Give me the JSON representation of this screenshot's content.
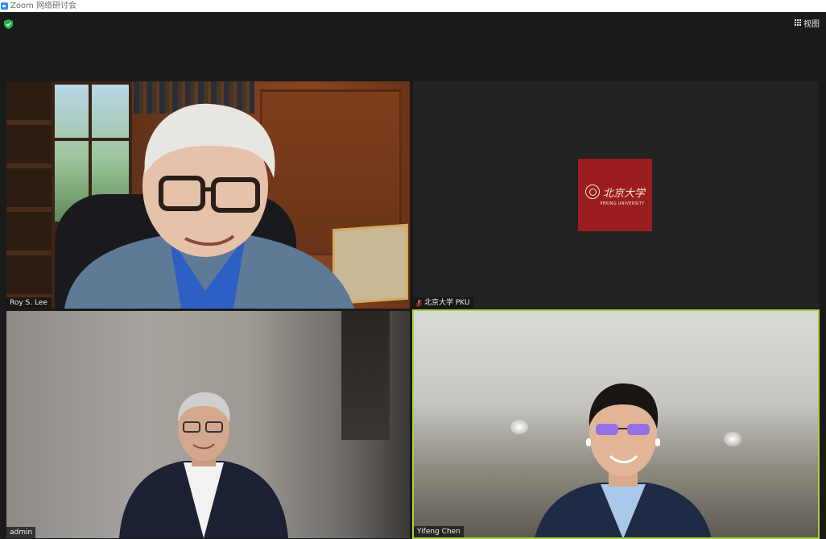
{
  "window": {
    "title": "Zoom 网络研讨会"
  },
  "toolbar": {
    "view_label": "视图"
  },
  "participants": [
    {
      "name": "Roy S. Lee",
      "muted": false
    },
    {
      "name": "北京大学 PKU",
      "muted": true
    },
    {
      "name": "admin",
      "muted": false
    },
    {
      "name": "Yifeng Chen",
      "muted": false,
      "active_speaker": true
    }
  ],
  "pku_logo": {
    "chinese": "北京大学",
    "english": "PEKING UNIVERSITY"
  },
  "colors": {
    "active_speaker_border": "#a8d23a",
    "pku_red": "#9b1d1d",
    "shield_green": "#23b14d"
  }
}
